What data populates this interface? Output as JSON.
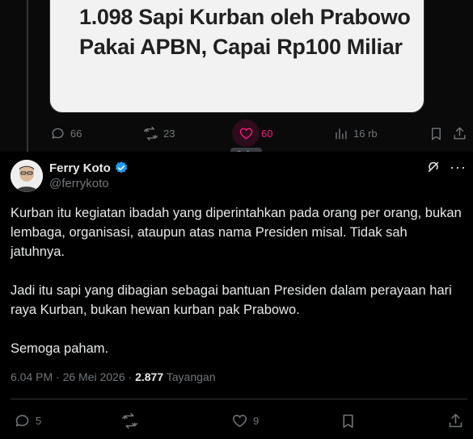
{
  "prev_tweet": {
    "headline": "1.098 Sapi Kurban oleh Prabowo Pakai APBN, Capai Rp100 Miliar",
    "actions": {
      "reply_count": "66",
      "retweet_count": "23",
      "like_count": "60",
      "views_count": "16 rb"
    },
    "tooltip": "Suka"
  },
  "tweet": {
    "author_name": "Ferry Koto",
    "author_handle": "@ferrykoto",
    "paragraphs": [
      "Kurban itu kegiatan ibadah yang diperintahkan pada orang per orang, bukan lembaga, organisasi, ataupun atas nama Presiden misal. Tidak sah jatuhnya.",
      "Jadi itu sapi yang dibagian sebagai bantuan Presiden dalam perayaan hari raya Kurban, bukan hewan kurban pak Prabowo.",
      "Semoga paham."
    ],
    "timestamp": "6.04 PM · 26 Mei 2026 · ",
    "views_count": "2.877",
    "views_label": "Tayangan",
    "actions": {
      "reply_count": "5",
      "like_count": "9"
    }
  },
  "colors": {
    "like_accent": "#f91880",
    "verified_blue": "#1d9bf0",
    "muted": "#71767b"
  }
}
